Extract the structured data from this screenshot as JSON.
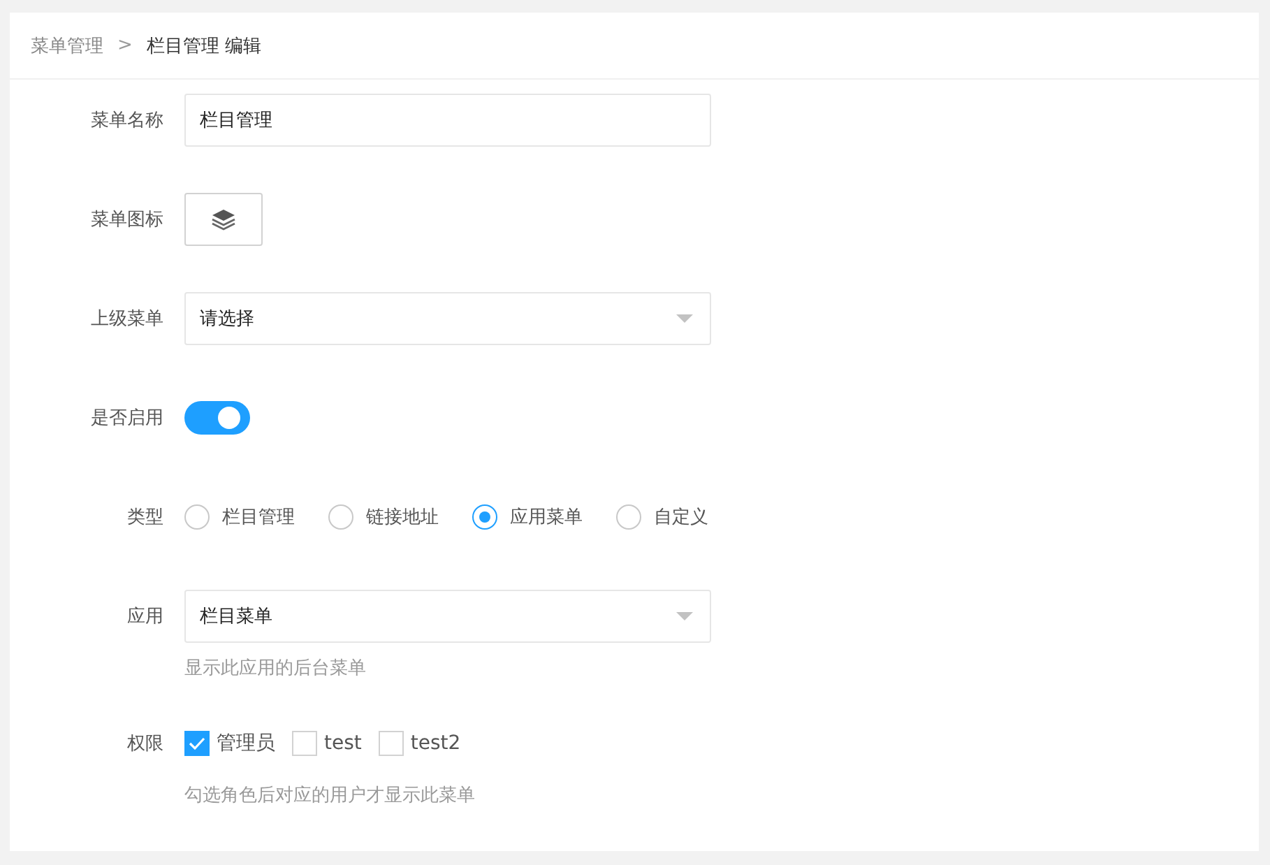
{
  "breadcrumb": {
    "parent": "菜单管理",
    "separator": ">",
    "current": "栏目管理 编辑"
  },
  "fields": [
    {
      "kind": "text",
      "label": "菜单名称",
      "value": "栏目管理"
    },
    {
      "kind": "icon",
      "label": "菜单图标"
    },
    {
      "kind": "select",
      "label": "上级菜单",
      "value": "请选择"
    },
    {
      "kind": "switch",
      "label": "是否启用",
      "on": true
    },
    {
      "kind": "radio",
      "label": "类型",
      "options": [
        {
          "label": "栏目管理",
          "selected": false
        },
        {
          "label": "链接地址",
          "selected": false
        },
        {
          "label": "应用菜单",
          "selected": true
        },
        {
          "label": "自定义",
          "selected": false
        }
      ]
    },
    {
      "kind": "select",
      "label": "应用",
      "value": "栏目菜单",
      "hint": "显示此应用的后台菜单"
    },
    {
      "kind": "checkbox",
      "label": "权限",
      "options": [
        {
          "label": "管理员",
          "checked": true
        },
        {
          "label": "test",
          "checked": false
        },
        {
          "label": "test2",
          "checked": false
        }
      ],
      "hint": "勾选角色后对应的用户才显示此菜单"
    }
  ]
}
